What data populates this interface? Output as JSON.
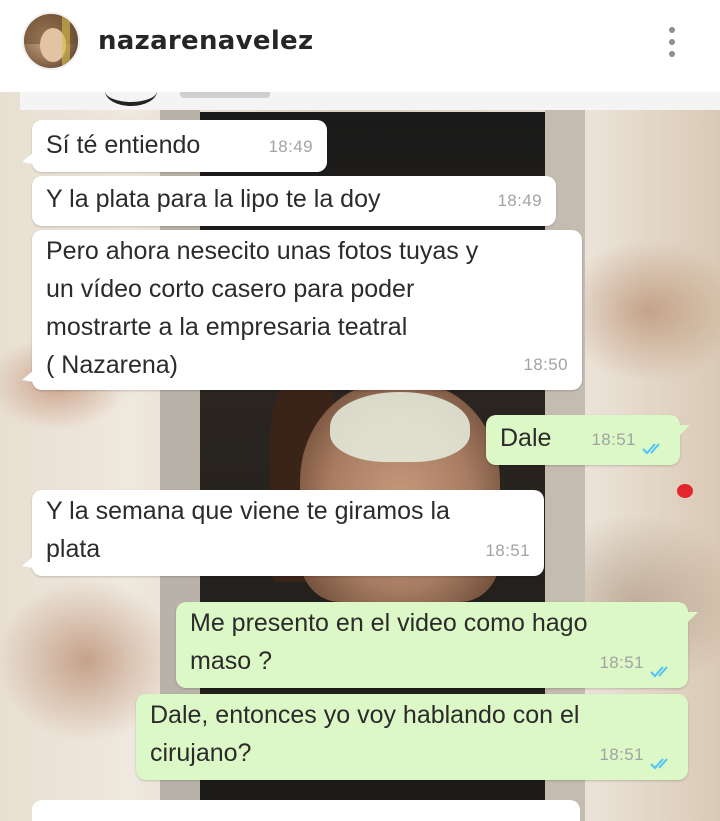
{
  "header": {
    "username": "nazarenavelez",
    "avatar_icon": "profile-avatar",
    "more_icon": "more-vertical-icon"
  },
  "chat": {
    "ticks_color": "#4fc3f7",
    "messages": [
      {
        "dir": "in",
        "text": "Sí té entiendo",
        "time": "18:49"
      },
      {
        "dir": "in",
        "text": "Y la plata para la lipo te la doy",
        "time": "18:49"
      },
      {
        "dir": "in",
        "text": "Pero ahora nesecito unas fotos tuyas y\nun vídeo corto casero para poder\nmostrarte a la empresaria teatral\n( Nazarena)",
        "time": "18:50"
      },
      {
        "dir": "out",
        "text": "Dale",
        "time": "18:51"
      },
      {
        "dir": "in",
        "text": "Y la semana que viene te giramos la\nplata",
        "time": "18:51"
      },
      {
        "dir": "out",
        "text": "Me presento en el video como hago\nmaso ?",
        "time": "18:51"
      },
      {
        "dir": "out",
        "text": "Dale, entonces yo voy hablando con el\ncirujano?",
        "time": "18:51"
      }
    ]
  }
}
